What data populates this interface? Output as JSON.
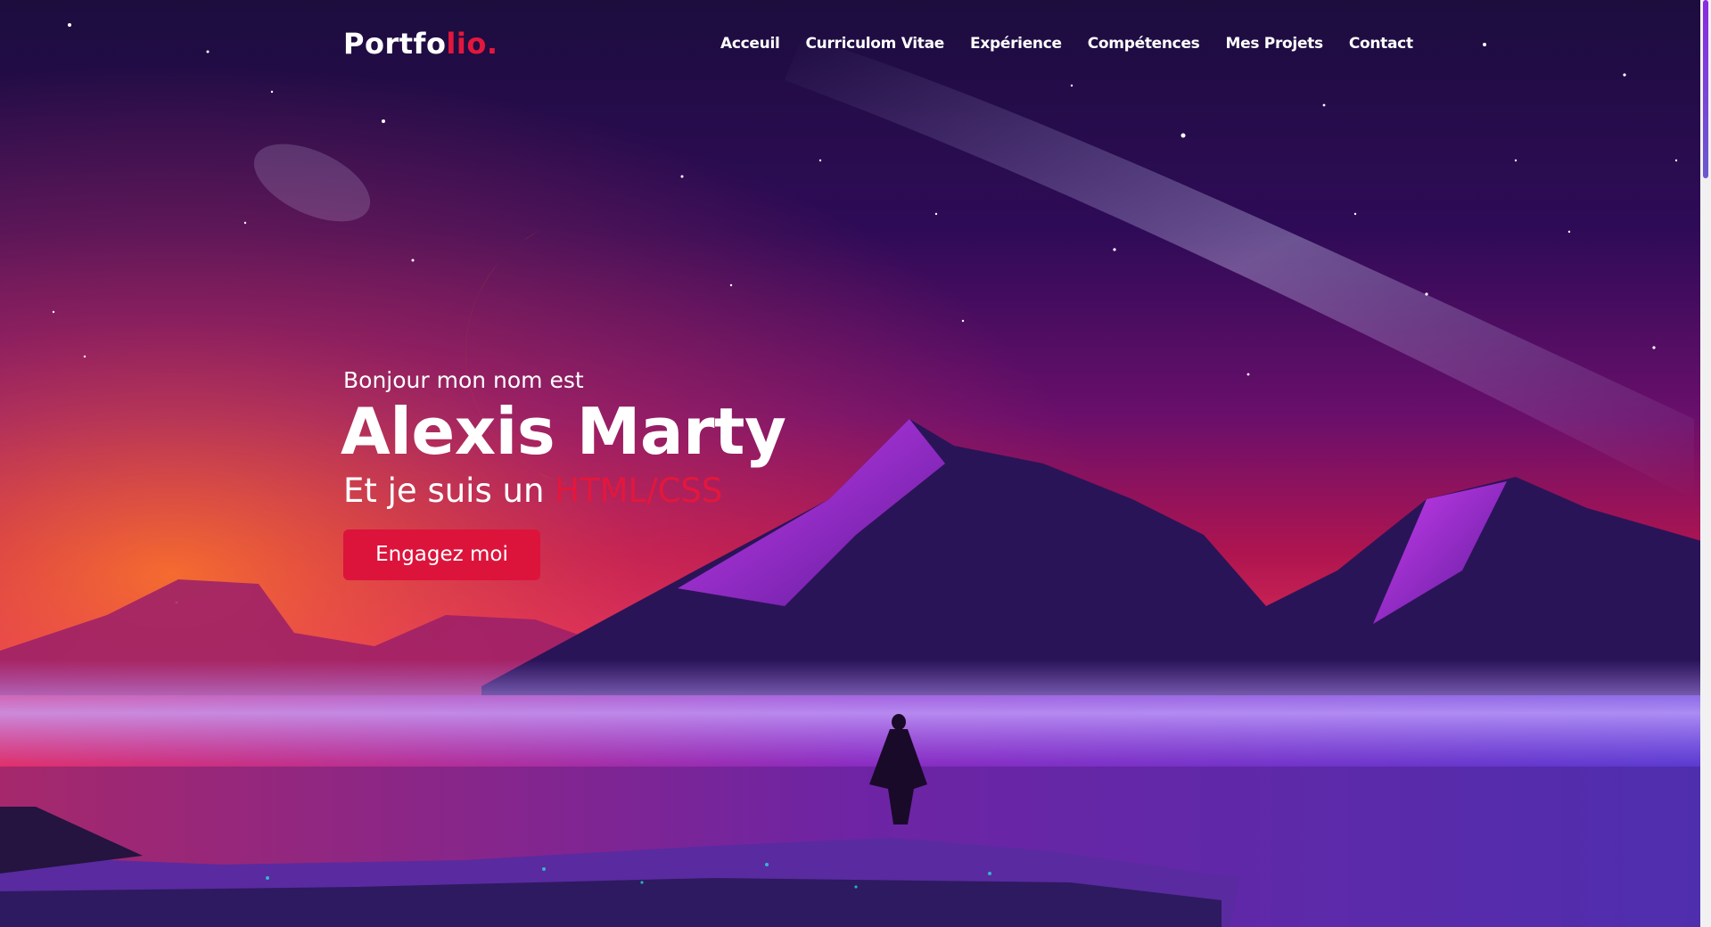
{
  "brand": {
    "text": "Portfo",
    "accent": "lio."
  },
  "nav": {
    "items": [
      {
        "label": "Acceuil"
      },
      {
        "label": "Curriculom Vitae"
      },
      {
        "label": "Expérience"
      },
      {
        "label": "Compétences"
      },
      {
        "label": "Mes Projets"
      },
      {
        "label": "Contact"
      }
    ]
  },
  "hero": {
    "greeting": "Bonjour mon nom est",
    "name": "Alexis Marty",
    "role_prefix": "Et je suis un",
    "role_typed": "HTML/CSS",
    "cta_label": "Engagez moi"
  },
  "colors": {
    "accent": "#e3173d",
    "button": "#dc143c",
    "text": "#ffffff"
  }
}
